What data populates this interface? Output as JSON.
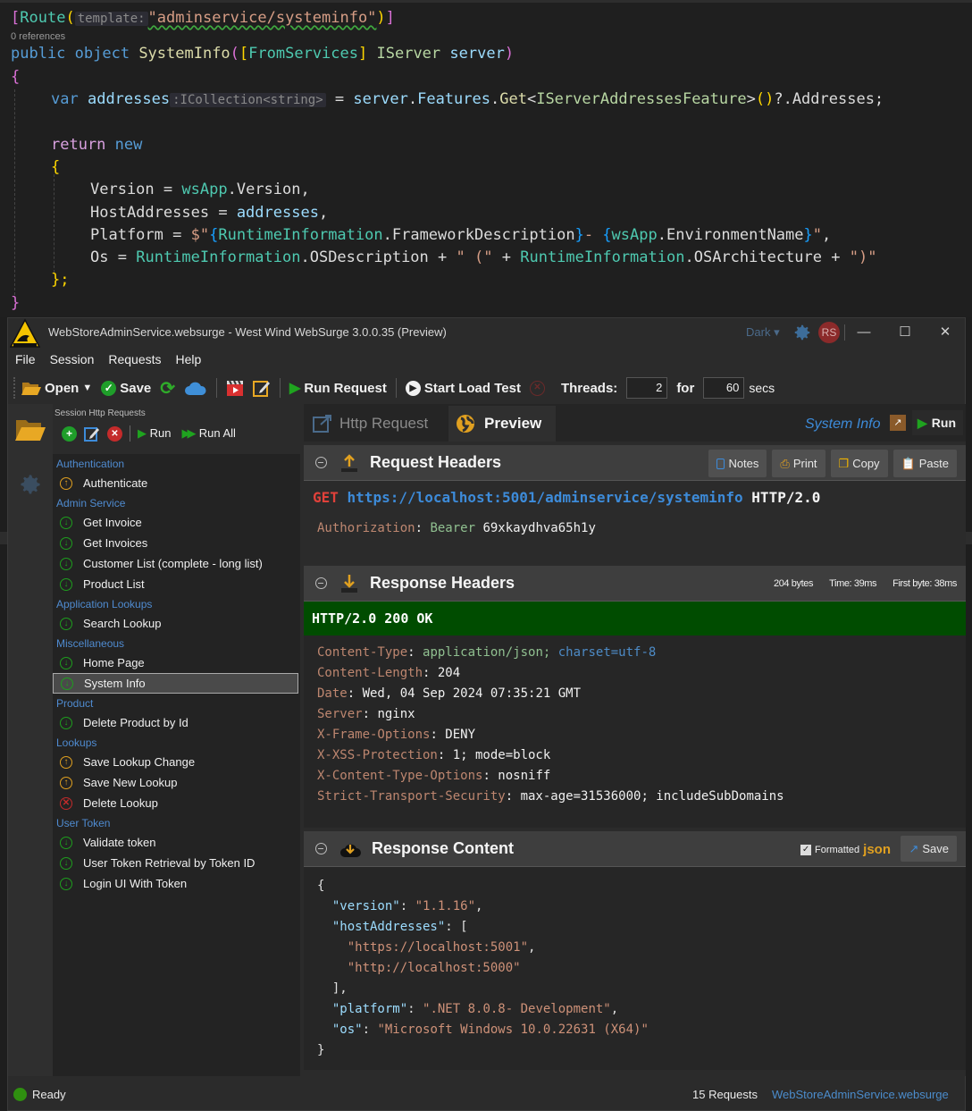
{
  "editor": {
    "attribute_line": {
      "attr": "Route",
      "hint": "template:",
      "value": "\"adminservice/systeminfo\""
    },
    "references": "0 references",
    "signature": {
      "modifiers": "public object",
      "method": "SystemInfo",
      "attr": "FromServices",
      "param_type": "IServer",
      "param_name": "server"
    },
    "line_var": {
      "kw": "var",
      "name": "addresses",
      "hint": ":ICollection<string>",
      "rhs_obj": "server",
      "rhs_prop": "Features",
      "rhs_method": "Get",
      "rhs_type": "IServerAddressesFeature",
      "rhs_tail": "?.Addresses;"
    },
    "line_return": {
      "kw1": "return",
      "kw2": "new"
    },
    "props": [
      {
        "name": "Version",
        "type": "wsApp",
        "member": "Version"
      },
      {
        "name": "HostAddresses",
        "value": "addresses"
      },
      {
        "name": "Platform",
        "type1": "RuntimeInformation",
        "member1": "FrameworkDescription",
        "type2": "wsApp",
        "member2": "EnvironmentName"
      },
      {
        "name": "Os",
        "type1": "RuntimeInformation",
        "member1": "OSDescription",
        "type2": "RuntimeInformation",
        "member2": "OSArchitecture"
      }
    ]
  },
  "window": {
    "title": "WebStoreAdminService.websurge - West Wind WebSurge 3.0.0.35 (Preview)",
    "theme": "Dark",
    "avatar_initials": "RS",
    "controls": {
      "minimize": "—",
      "maximize": "☐",
      "close": "✕"
    }
  },
  "menu": [
    "File",
    "Session",
    "Requests",
    "Help"
  ],
  "toolbar": {
    "open": "Open",
    "save": "Save",
    "run_request": "Run Request",
    "start_load_test": "Start Load Test",
    "threads_label": "Threads:",
    "threads_value": "2",
    "for_label": "for",
    "duration_value": "60",
    "secs_label": "secs"
  },
  "session": {
    "caption": "Session Http Requests",
    "run": "Run",
    "run_all": "Run All",
    "groups": [
      {
        "name": "Authentication",
        "items": [
          {
            "label": "Authenticate",
            "verb": "up"
          }
        ]
      },
      {
        "name": "Admin Service",
        "items": [
          {
            "label": "Get Invoice",
            "verb": "down"
          },
          {
            "label": "Get Invoices",
            "verb": "down"
          },
          {
            "label": "Customer List (complete - long list)",
            "verb": "down"
          },
          {
            "label": "Product List",
            "verb": "down"
          }
        ]
      },
      {
        "name": "Application Lookups",
        "items": [
          {
            "label": "Search Lookup",
            "verb": "down"
          }
        ]
      },
      {
        "name": "Miscellaneous",
        "items": [
          {
            "label": "Home Page",
            "verb": "down"
          },
          {
            "label": "System Info",
            "verb": "down",
            "selected": true
          }
        ]
      },
      {
        "name": "Product",
        "items": [
          {
            "label": "Delete Product by Id",
            "verb": "down"
          }
        ]
      },
      {
        "name": "Lookups",
        "items": [
          {
            "label": "Save Lookup Change",
            "verb": "up"
          },
          {
            "label": "Save New Lookup",
            "verb": "up"
          },
          {
            "label": "Delete Lookup",
            "verb": "del"
          }
        ]
      },
      {
        "name": "User Token",
        "items": [
          {
            "label": "Validate token",
            "verb": "down"
          },
          {
            "label": "User Token Retrieval by Token ID",
            "verb": "down"
          },
          {
            "label": "Login UI With Token",
            "verb": "down"
          }
        ]
      }
    ]
  },
  "tabs": {
    "http_request": "Http Request",
    "preview": "Preview",
    "current_request": "System Info",
    "run": "Run"
  },
  "request": {
    "title": "Request Headers",
    "buttons": {
      "notes": "Notes",
      "print": "Print",
      "copy": "Copy",
      "paste": "Paste"
    },
    "method": "GET",
    "url": "https://localhost:5001/adminservice/systeminfo",
    "protocol": "HTTP/2.0",
    "headers": [
      {
        "key": "Authorization",
        "scheme": "Bearer",
        "value": "69xkaydhva65h1y"
      }
    ]
  },
  "response": {
    "title": "Response Headers",
    "bytes": "204 bytes",
    "time": "Time: 39ms",
    "first_byte": "First byte: 38ms",
    "status_line": "HTTP/2.0 200 OK",
    "headers": [
      {
        "key": "Content-Type",
        "value": "application/json;",
        "extra": "charset=utf-8"
      },
      {
        "key": "Content-Length",
        "value": "204"
      },
      {
        "key": "Date",
        "value": "Wed, 04 Sep 2024 07:35:21 GMT"
      },
      {
        "key": "Server",
        "value": "nginx"
      },
      {
        "key": "X-Frame-Options",
        "value": "DENY"
      },
      {
        "key": "X-XSS-Protection",
        "value": "1; mode=block"
      },
      {
        "key": "X-Content-Type-Options",
        "value": "nosniff"
      },
      {
        "key": "Strict-Transport-Security",
        "value": "max-age=31536000; includeSubDomains"
      }
    ]
  },
  "content": {
    "title": "Response Content",
    "formatted_label": "Formatted",
    "formatted_checked": true,
    "format": "json",
    "save": "Save",
    "json": {
      "version": "1.1.16",
      "hostAddresses": [
        "https://localhost:5001",
        "http://localhost:5000"
      ],
      "platform": ".NET 8.0.8- Development",
      "os": "Microsoft Windows 10.0.22631 (X64)"
    }
  },
  "statusbar": {
    "status": "Ready",
    "request_count": "15 Requests",
    "session_file": "WebStoreAdminService.websurge"
  },
  "colors": {
    "accent": "#3d8bd9",
    "ok_status": "#004c00",
    "method_get": "#e0413a",
    "verb_down": "#1e9e1e",
    "verb_up": "#e0a020",
    "verb_delete": "#c42b2b"
  }
}
